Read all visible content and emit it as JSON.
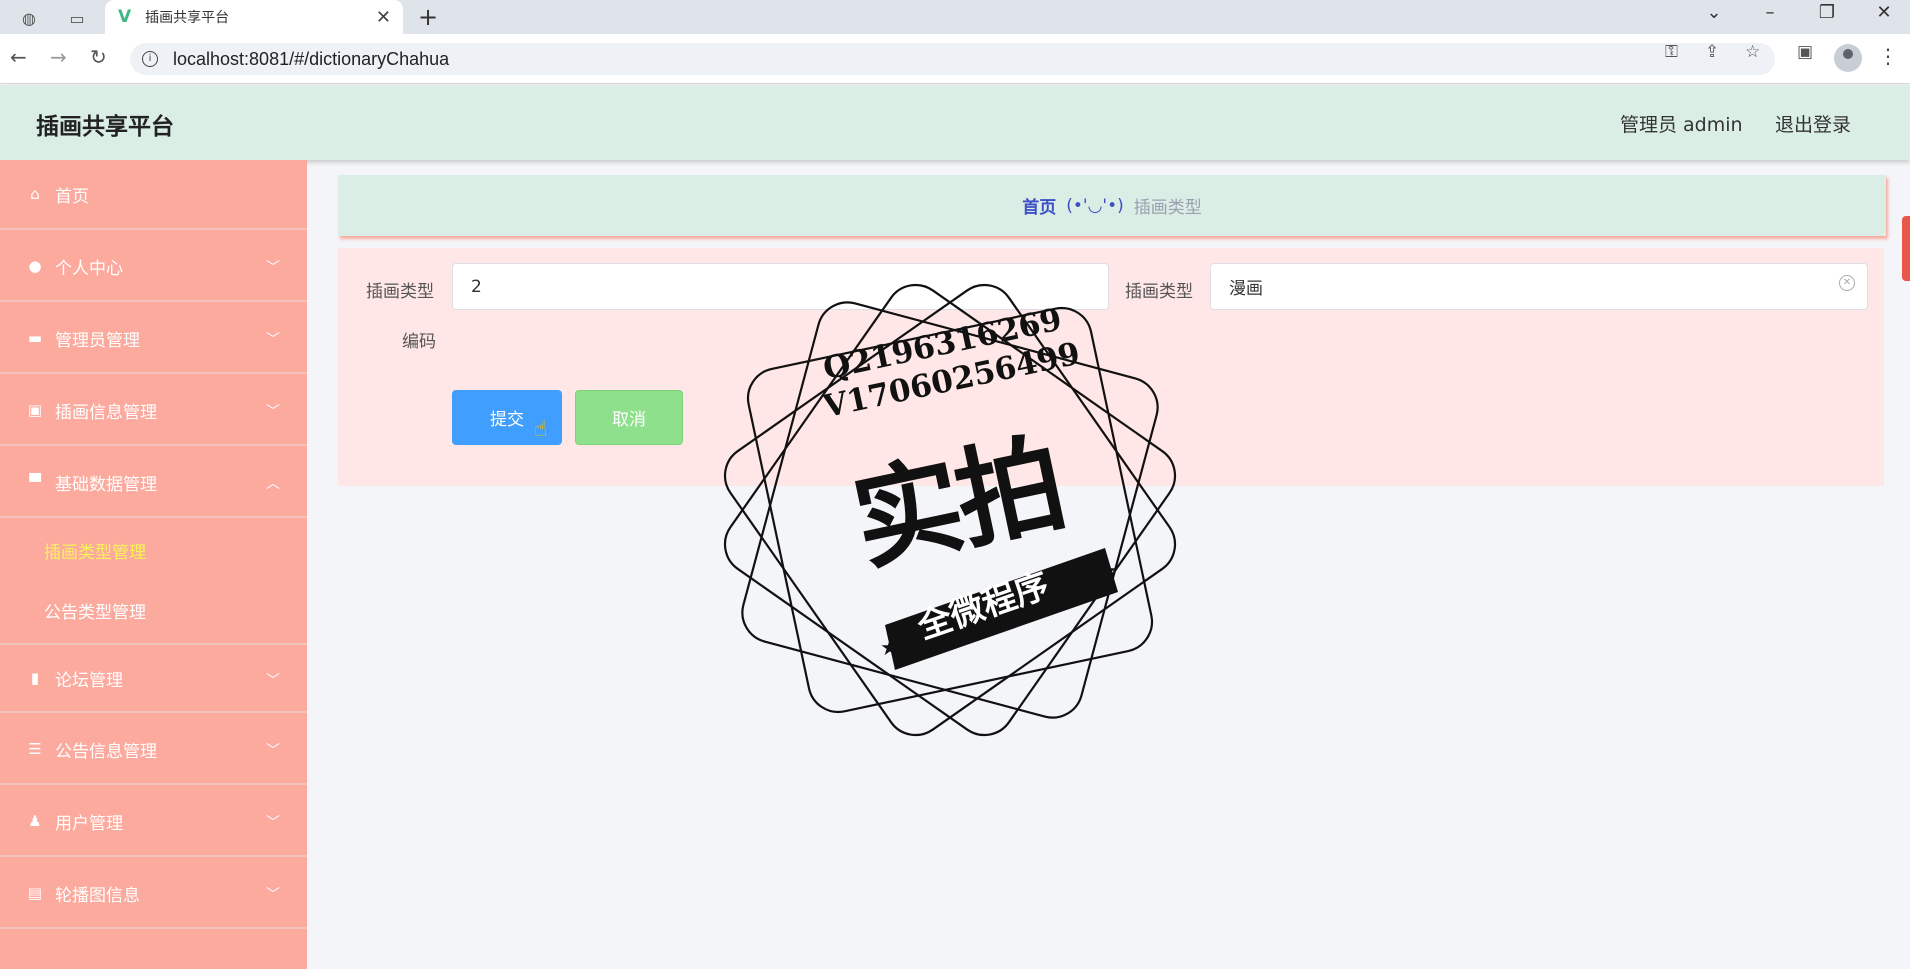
{
  "browser": {
    "tab_title": "插画共享平台",
    "url": "localhost:8081/#/dictionaryChahua"
  },
  "header": {
    "app_title": "插画共享平台",
    "user_label": "管理员 admin",
    "logout_label": "退出登录"
  },
  "sidebar": {
    "items": [
      {
        "label": "首页",
        "icon": "home-icon"
      },
      {
        "label": "个人中心",
        "icon": "user-icon"
      },
      {
        "label": "管理员管理",
        "icon": "briefcase-icon"
      },
      {
        "label": "插画信息管理",
        "icon": "clipboard-icon"
      },
      {
        "label": "基础数据管理",
        "icon": "monitor-icon"
      },
      {
        "label": "论坛管理",
        "icon": "bar-chart-icon"
      },
      {
        "label": "公告信息管理",
        "icon": "list-icon"
      },
      {
        "label": "用户管理",
        "icon": "stamp-icon"
      },
      {
        "label": "轮播图信息",
        "icon": "document-icon"
      }
    ],
    "sub_items": [
      {
        "label": "插画类型管理",
        "active": true
      },
      {
        "label": "公告类型管理",
        "active": false
      }
    ]
  },
  "breadcrumb": {
    "home": "首页",
    "separator": "(•'◡'•)",
    "current": "插画类型"
  },
  "form": {
    "code_label_line1": "插画类型",
    "code_label_line2": "编码",
    "code_value": "2",
    "name_label": "插画类型",
    "name_value": "漫画",
    "submit_label": "提交",
    "cancel_label": "取消"
  },
  "watermark": {
    "qq": "Q2196316269",
    "wx": "V17060256499",
    "main": "实拍",
    "ribbon": "全微程序"
  },
  "colors": {
    "header_bg": "#dbeee5",
    "sidebar_bg": "#fcaa9e",
    "active_sub": "#f7f25a",
    "submit_bg": "#409eff",
    "cancel_bg": "#8fe08c",
    "panel_bg": "#ffe7e7"
  }
}
